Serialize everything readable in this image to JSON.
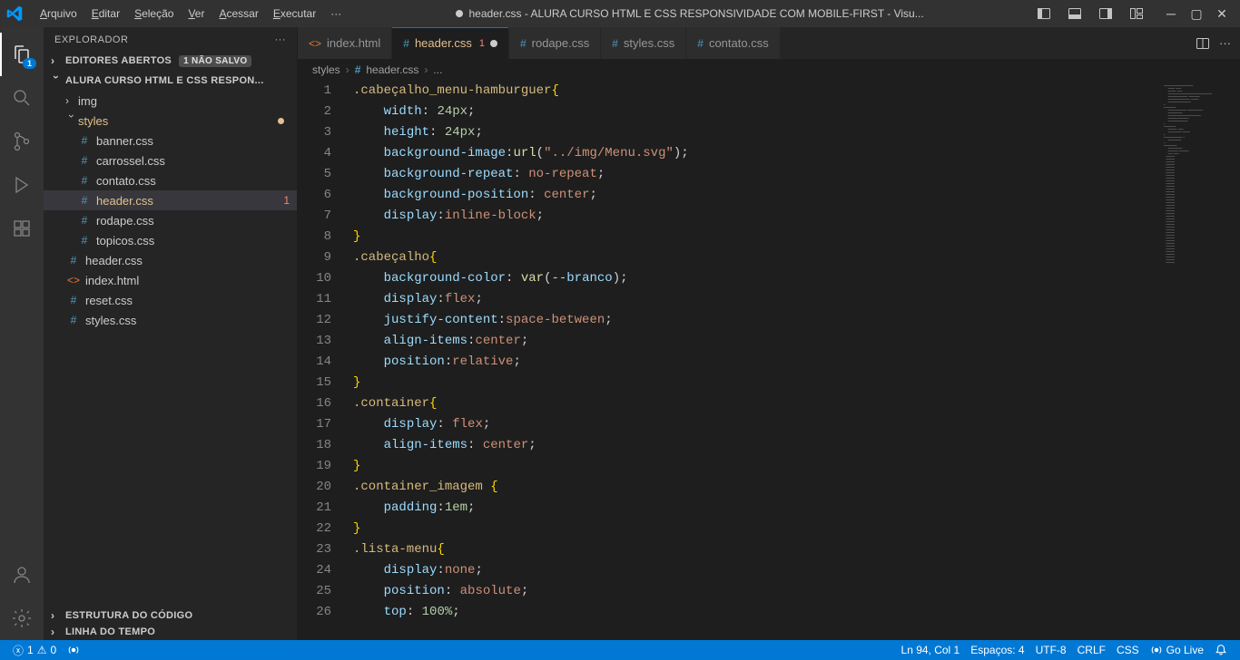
{
  "app": {
    "title": "header.css - ALURA CURSO HTML E CSS RESPONSIVIDADE COM MOBILE-FIRST - Visu..."
  },
  "menubar": {
    "items": [
      {
        "label": "Arquivo",
        "m": "A"
      },
      {
        "label": "Editar",
        "m": "E"
      },
      {
        "label": "Seleção",
        "m": "S"
      },
      {
        "label": "Ver",
        "m": "V"
      },
      {
        "label": "Acessar",
        "m": "A"
      },
      {
        "label": "Executar",
        "m": "E"
      }
    ],
    "overflow": "···"
  },
  "activitybar": {
    "explorer_badge": "1"
  },
  "explorer": {
    "title": "EXPLORADOR",
    "open_editors_label": "EDITORES ABERTOS",
    "unsaved_pill": "1 NÃO SALVO",
    "folder_label": "ALURA CURSO HTML E CSS RESPON...",
    "outline_label": "ESTRUTURA DO CÓDIGO",
    "timeline_label": "LINHA DO TEMPO",
    "items": {
      "img": "img",
      "styles": "styles",
      "banner": "banner.css",
      "carrossel": "carrossel.css",
      "contato": "contato.css",
      "header": "header.css",
      "rodape": "rodape.css",
      "topicos": "topicos.css",
      "root_header": "header.css",
      "root_index": "index.html",
      "root_reset": "reset.css",
      "root_styles": "styles.css"
    },
    "header_problem_badge": "1"
  },
  "tabs": [
    {
      "icon": "html",
      "label": "index.html",
      "active": false,
      "modified": false,
      "problem": ""
    },
    {
      "icon": "css",
      "label": "header.css",
      "active": true,
      "modified": true,
      "problem": "1"
    },
    {
      "icon": "css",
      "label": "rodape.css",
      "active": false,
      "modified": false,
      "problem": ""
    },
    {
      "icon": "css",
      "label": "styles.css",
      "active": false,
      "modified": false,
      "problem": ""
    },
    {
      "icon": "css",
      "label": "contato.css",
      "active": false,
      "modified": false,
      "problem": ""
    }
  ],
  "breadcrumbs": {
    "seg1": "styles",
    "seg2": "header.css",
    "seg3": "..."
  },
  "code": {
    "lines": [
      [
        {
          "t": "sel",
          "v": ".cabeçalho_menu-hamburguer"
        },
        {
          "t": "brace",
          "v": "{"
        }
      ],
      [
        {
          "t": "ind",
          "v": "    "
        },
        {
          "t": "prop",
          "v": "width"
        },
        {
          "t": "punc",
          "v": ": "
        },
        {
          "t": "num",
          "v": "24px"
        },
        {
          "t": "punc",
          "v": ";"
        }
      ],
      [
        {
          "t": "ind",
          "v": "    "
        },
        {
          "t": "prop",
          "v": "height"
        },
        {
          "t": "punc",
          "v": ": "
        },
        {
          "t": "num",
          "v": "24px"
        },
        {
          "t": "punc",
          "v": ";"
        }
      ],
      [
        {
          "t": "ind",
          "v": "    "
        },
        {
          "t": "prop",
          "v": "background-image"
        },
        {
          "t": "punc",
          "v": ":"
        },
        {
          "t": "func",
          "v": "url"
        },
        {
          "t": "punc",
          "v": "("
        },
        {
          "t": "val",
          "v": "\"../img/Menu.svg\""
        },
        {
          "t": "punc",
          "v": ");"
        }
      ],
      [
        {
          "t": "ind",
          "v": "    "
        },
        {
          "t": "prop",
          "v": "background-repeat"
        },
        {
          "t": "punc",
          "v": ": "
        },
        {
          "t": "val",
          "v": "no-repeat"
        },
        {
          "t": "punc",
          "v": ";"
        }
      ],
      [
        {
          "t": "ind",
          "v": "    "
        },
        {
          "t": "prop",
          "v": "background-position"
        },
        {
          "t": "punc",
          "v": ": "
        },
        {
          "t": "val",
          "v": "center"
        },
        {
          "t": "punc",
          "v": ";"
        }
      ],
      [
        {
          "t": "ind",
          "v": "    "
        },
        {
          "t": "prop",
          "v": "display"
        },
        {
          "t": "punc",
          "v": ":"
        },
        {
          "t": "val",
          "v": "inline-block"
        },
        {
          "t": "punc",
          "v": ";"
        }
      ],
      [
        {
          "t": "brace",
          "v": "}"
        }
      ],
      [
        {
          "t": "sel",
          "v": ".cabeçalho"
        },
        {
          "t": "brace",
          "v": "{"
        }
      ],
      [
        {
          "t": "ind",
          "v": "    "
        },
        {
          "t": "prop",
          "v": "background-color"
        },
        {
          "t": "punc",
          "v": ": "
        },
        {
          "t": "func",
          "v": "var"
        },
        {
          "t": "punc",
          "v": "("
        },
        {
          "t": "prop",
          "v": "--branco"
        },
        {
          "t": "punc",
          "v": ");"
        }
      ],
      [
        {
          "t": "ind",
          "v": "    "
        },
        {
          "t": "prop",
          "v": "display"
        },
        {
          "t": "punc",
          "v": ":"
        },
        {
          "t": "val",
          "v": "flex"
        },
        {
          "t": "punc",
          "v": ";"
        }
      ],
      [
        {
          "t": "ind",
          "v": "    "
        },
        {
          "t": "prop",
          "v": "justify-content"
        },
        {
          "t": "punc",
          "v": ":"
        },
        {
          "t": "val",
          "v": "space-between"
        },
        {
          "t": "punc",
          "v": ";"
        }
      ],
      [
        {
          "t": "ind",
          "v": "    "
        },
        {
          "t": "prop",
          "v": "align-items"
        },
        {
          "t": "punc",
          "v": ":"
        },
        {
          "t": "val",
          "v": "center"
        },
        {
          "t": "punc",
          "v": ";"
        }
      ],
      [
        {
          "t": "ind",
          "v": "    "
        },
        {
          "t": "prop",
          "v": "position"
        },
        {
          "t": "punc",
          "v": ":"
        },
        {
          "t": "val",
          "v": "relative"
        },
        {
          "t": "punc",
          "v": ";"
        }
      ],
      [
        {
          "t": "brace",
          "v": "}"
        }
      ],
      [
        {
          "t": "sel",
          "v": ".container"
        },
        {
          "t": "brace",
          "v": "{"
        }
      ],
      [
        {
          "t": "ind",
          "v": "    "
        },
        {
          "t": "prop",
          "v": "display"
        },
        {
          "t": "punc",
          "v": ": "
        },
        {
          "t": "val",
          "v": "flex"
        },
        {
          "t": "punc",
          "v": ";"
        }
      ],
      [
        {
          "t": "ind",
          "v": "    "
        },
        {
          "t": "prop",
          "v": "align-items"
        },
        {
          "t": "punc",
          "v": ": "
        },
        {
          "t": "val",
          "v": "center"
        },
        {
          "t": "punc",
          "v": ";"
        }
      ],
      [
        {
          "t": "brace",
          "v": "}"
        }
      ],
      [
        {
          "t": "sel",
          "v": ".container_imagem "
        },
        {
          "t": "brace",
          "v": "{"
        }
      ],
      [
        {
          "t": "ind",
          "v": "    "
        },
        {
          "t": "prop",
          "v": "padding"
        },
        {
          "t": "punc",
          "v": ":"
        },
        {
          "t": "num",
          "v": "1em"
        },
        {
          "t": "punc",
          "v": ";"
        }
      ],
      [
        {
          "t": "brace",
          "v": "}"
        }
      ],
      [
        {
          "t": "sel",
          "v": ".lista-menu"
        },
        {
          "t": "brace",
          "v": "{"
        }
      ],
      [
        {
          "t": "ind",
          "v": "    "
        },
        {
          "t": "prop",
          "v": "display"
        },
        {
          "t": "punc",
          "v": ":"
        },
        {
          "t": "val",
          "v": "none"
        },
        {
          "t": "punc",
          "v": ";"
        }
      ],
      [
        {
          "t": "ind",
          "v": "    "
        },
        {
          "t": "prop",
          "v": "position"
        },
        {
          "t": "punc",
          "v": ": "
        },
        {
          "t": "val",
          "v": "absolute"
        },
        {
          "t": "punc",
          "v": ";"
        }
      ],
      [
        {
          "t": "ind",
          "v": "    "
        },
        {
          "t": "prop",
          "v": "top"
        },
        {
          "t": "punc",
          "v": ": "
        },
        {
          "t": "num",
          "v": "100%"
        },
        {
          "t": "punc",
          "v": ";"
        }
      ]
    ],
    "start_line": 1
  },
  "statusbar": {
    "errors": "1",
    "warnings": "0",
    "cursor": "Ln 94, Col 1",
    "spaces": "Espaços: 4",
    "encoding": "UTF-8",
    "eol": "CRLF",
    "lang": "CSS",
    "golive": "Go Live"
  }
}
